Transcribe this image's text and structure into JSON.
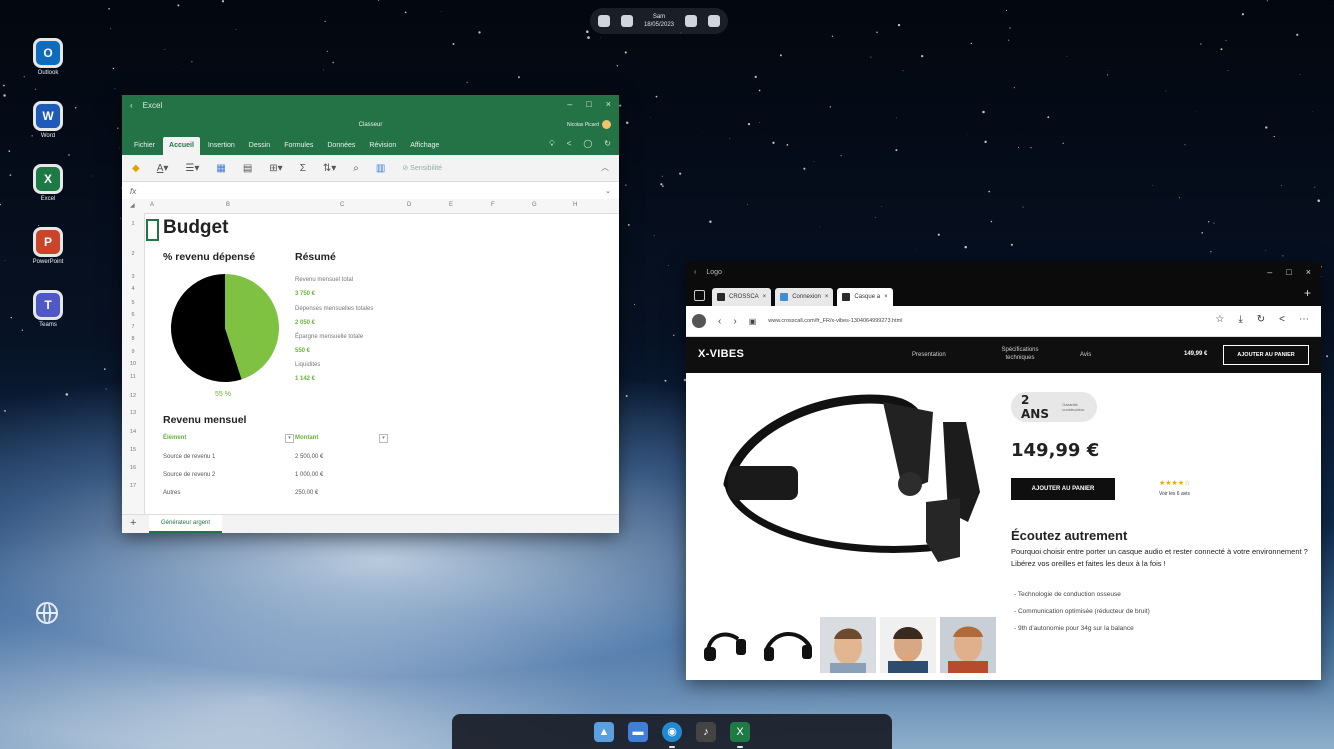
{
  "top_bar": {
    "time": "Sam",
    "date": "18/05/2023"
  },
  "desktop_icons": [
    {
      "label": "Outlook",
      "letter": "O",
      "color": "#0f6cbd"
    },
    {
      "label": "Word",
      "letter": "W",
      "color": "#1e5bb8"
    },
    {
      "label": "Excel",
      "letter": "X",
      "color": "#1d7a45"
    },
    {
      "label": "PowerPoint",
      "letter": "P",
      "color": "#c8452a"
    },
    {
      "label": "Teams",
      "letter": "T",
      "color": "#4f58c4"
    }
  ],
  "excel": {
    "app_title": "Excel",
    "doc_title": "Classeur",
    "user": "Nicolas Picard",
    "tabs": [
      "Fichier",
      "Accueil",
      "Insertion",
      "Dessin",
      "Formules",
      "Données",
      "Révision",
      "Affichage"
    ],
    "active_tab": "Accueil",
    "sensitivity_label": "Sensibilité",
    "formula_prefix": "fx",
    "columns": [
      "A",
      "B",
      "C",
      "D",
      "E",
      "F",
      "G",
      "H"
    ],
    "rows": [
      "1",
      "2",
      "3",
      "4",
      "5",
      "6",
      "7",
      "8",
      "9",
      "10",
      "11",
      "12",
      "13",
      "14",
      "15",
      "16",
      "17"
    ],
    "title": "Budget",
    "pie_heading": "% revenu dépensé",
    "pie_percent": "55 %",
    "pie_value": 0.45,
    "summary_heading": "Résumé",
    "summary": [
      {
        "label": "Revenu mensuel total",
        "value": "3 750 €"
      },
      {
        "label": "Dépenses mensuelles totales",
        "value": "2 050 €"
      },
      {
        "label": "Épargne mensuelle totale",
        "value": "550 €"
      },
      {
        "label": "Liquidités",
        "value": "1 142 €"
      }
    ],
    "income_heading": "Revenu mensuel",
    "income_headers": [
      "Élément",
      "Montant"
    ],
    "income_rows": [
      {
        "item": "Source de revenu 1",
        "amount": "2 500,00 €"
      },
      {
        "item": "Source de revenu 2",
        "amount": "1 000,00 €"
      },
      {
        "item": "Autres",
        "amount": "250,00 €"
      }
    ],
    "sheet_tab": "Générateur argent",
    "colors": {
      "brand": "#237346",
      "accent": "#7fc242"
    }
  },
  "browser": {
    "app_title": "Logo",
    "tabs": [
      {
        "label": "CROSSCA"
      },
      {
        "label": "Connexion"
      },
      {
        "label": "Casque a"
      }
    ],
    "url": "www.crosscall.com/fr_FR/x-vibes-1304064999273.html",
    "site": {
      "logo": "X-VIBES",
      "nav": [
        "Presentation",
        "Spécifications techniques",
        "Avis"
      ],
      "nav_price": "149,99 €",
      "nav_button": "AJOUTER AU PANIER",
      "warranty_big": "2 ANS",
      "warranty_small": "Garantie constructeur",
      "price": "149,99 €",
      "cart_button": "AJOUTER AU PANIER",
      "rating": 4,
      "reviews": "Voir les 6 avis",
      "headline": "Écoutez autrement",
      "description": "Pourquoi choisir entre porter un casque audio et rester connecté à votre environnement ? Libérez vos oreilles et faites les deux à la fois !",
      "features": [
        "- Technologie de conduction osseuse",
        "- Communication optimisée (réducteur de bruit)",
        "- 9th d'autonomie pour 34g sur la balance"
      ]
    }
  }
}
